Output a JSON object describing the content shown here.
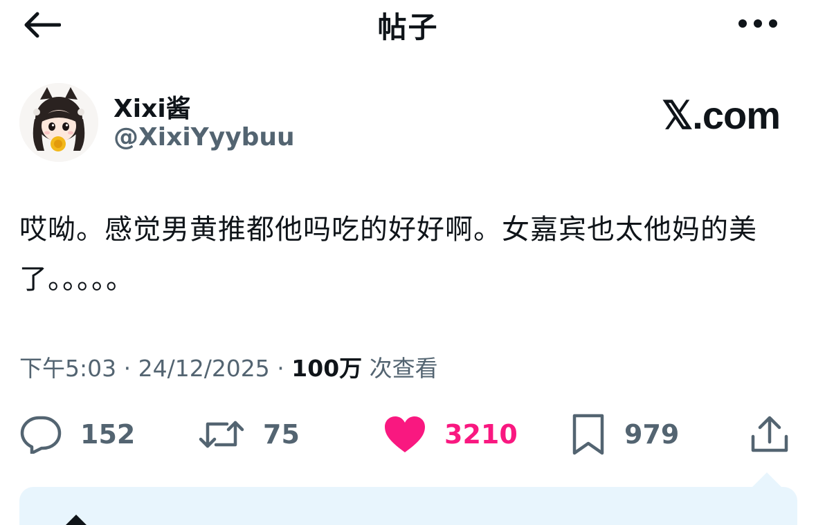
{
  "header": {
    "title": "帖子",
    "back_icon": "back-arrow-icon",
    "more_icon": "more-dots-icon"
  },
  "post": {
    "display_name": "Xixi酱",
    "handle": "@XixiYyybuu",
    "watermark": "𝕏.com",
    "text": "哎呦。感觉男黄推都他吗吃的好好啊。女嘉宾也太他妈的美了。。。。。",
    "time": "下午5:03",
    "date": "24/12/2025",
    "views": "100万",
    "views_label": "次查看"
  },
  "actions": {
    "replies": "152",
    "reposts": "75",
    "likes": "3210",
    "bookmarks": "979"
  },
  "colors": {
    "text": "#0f1419",
    "secondary": "#536471",
    "like": "#f91880",
    "reply_panel": "#e8f5fd"
  }
}
